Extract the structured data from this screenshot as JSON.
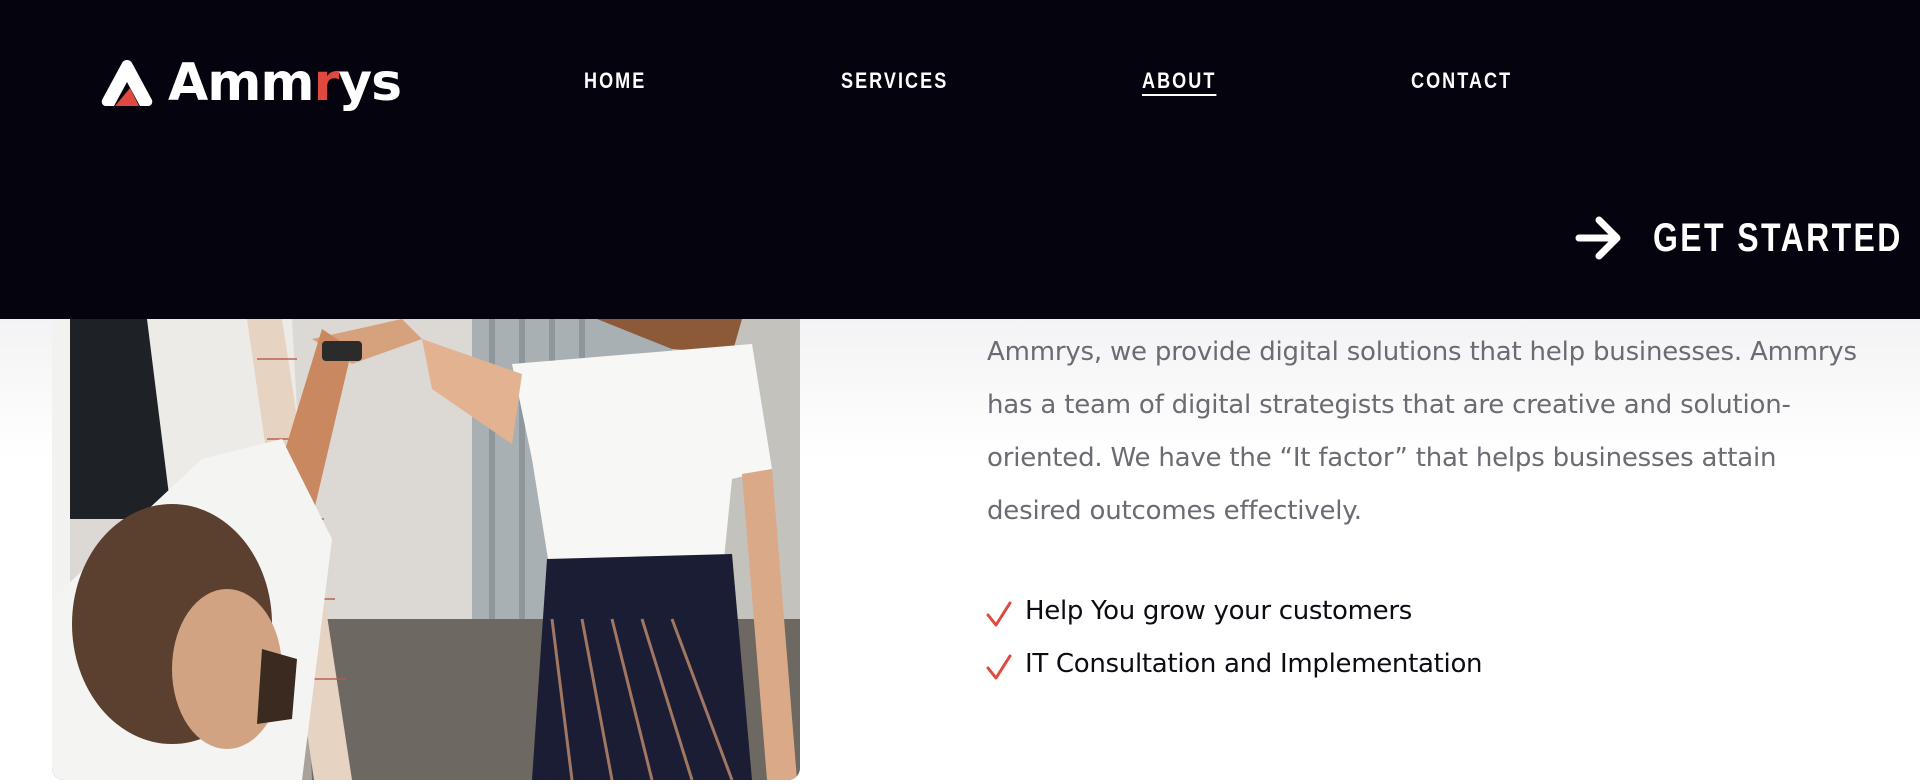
{
  "header": {
    "logo": {
      "text_main": "Amm",
      "text_accent": "r",
      "text_end": "ys",
      "icon": "ammrys-logo-icon"
    },
    "nav": [
      {
        "label": "HOME",
        "active": false
      },
      {
        "label": "SERVICES",
        "active": false
      },
      {
        "label": "ABOUT",
        "active": true
      },
      {
        "label": "CONTACT",
        "active": false
      }
    ],
    "cta": {
      "label": "GET STARTED",
      "icon": "arrow-right-icon"
    }
  },
  "about": {
    "paragraph": "Ammrys, we provide digital solutions that help businesses. Ammrys has a team of digital strategists that are creative and solution-oriented. We have the “It factor” that helps businesses attain desired outcomes effectively.",
    "features": [
      {
        "label": "Help You grow your customers",
        "icon": "checkmark-icon"
      },
      {
        "label": "IT Consultation and Implementation",
        "icon": "checkmark-icon"
      }
    ]
  },
  "colors": {
    "header_bg": "#05040e",
    "accent": "#e0493f",
    "body_text": "#6b6b73",
    "heading_text": "#0c0c14"
  }
}
